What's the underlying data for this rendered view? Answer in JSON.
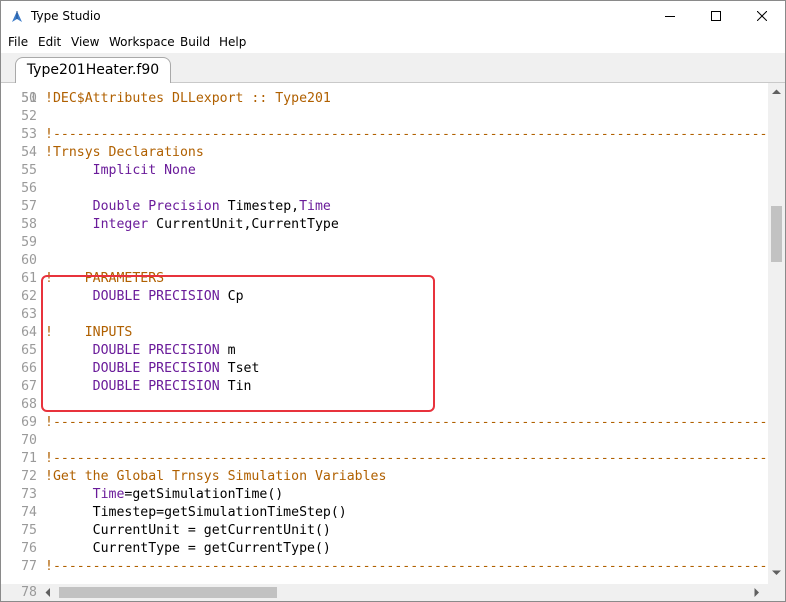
{
  "window": {
    "title": "Type Studio"
  },
  "menu": [
    "File",
    "Edit",
    "View",
    "Workspace",
    "Build",
    "Help"
  ],
  "tab": {
    "label": "Type201Heater.f90"
  },
  "lines": [
    {
      "n": "51",
      "segs": [
        {
          "t": "!DEC$Attributes DLLexport :: Type201",
          "c": "c-comment"
        }
      ]
    },
    {
      "n": "52",
      "segs": []
    },
    {
      "n": "53",
      "segs": [
        {
          "t": "!-----------------------------------------------------------------------------------------------------------",
          "c": "c-comment"
        }
      ]
    },
    {
      "n": "54",
      "segs": [
        {
          "t": "!Trnsys Declarations",
          "c": "c-comment"
        }
      ]
    },
    {
      "n": "55",
      "segs": [
        {
          "t": "      ",
          "c": "c-plain"
        },
        {
          "t": "Implicit None",
          "c": "c-kw"
        }
      ]
    },
    {
      "n": "56",
      "segs": []
    },
    {
      "n": "57",
      "segs": [
        {
          "t": "      ",
          "c": "c-plain"
        },
        {
          "t": "Double Precision",
          "c": "c-kw"
        },
        {
          "t": " Timestep,",
          "c": "c-plain"
        },
        {
          "t": "Time",
          "c": "c-kw"
        }
      ]
    },
    {
      "n": "58",
      "segs": [
        {
          "t": "      ",
          "c": "c-plain"
        },
        {
          "t": "Integer",
          "c": "c-kw"
        },
        {
          "t": " CurrentUnit,CurrentType",
          "c": "c-plain"
        }
      ]
    },
    {
      "n": "59",
      "segs": []
    },
    {
      "n": "60",
      "segs": []
    },
    {
      "n": "61",
      "segs": [
        {
          "t": "!    PARAMETERS",
          "c": "c-comment"
        }
      ]
    },
    {
      "n": "62",
      "segs": [
        {
          "t": "      ",
          "c": "c-plain"
        },
        {
          "t": "DOUBLE PRECISION",
          "c": "c-kw"
        },
        {
          "t": " Cp",
          "c": "c-plain"
        }
      ]
    },
    {
      "n": "63",
      "segs": []
    },
    {
      "n": "64",
      "segs": [
        {
          "t": "!    INPUTS",
          "c": "c-comment"
        }
      ]
    },
    {
      "n": "65",
      "segs": [
        {
          "t": "      ",
          "c": "c-plain"
        },
        {
          "t": "DOUBLE PRECISION",
          "c": "c-kw"
        },
        {
          "t": " m",
          "c": "c-plain"
        }
      ]
    },
    {
      "n": "66",
      "segs": [
        {
          "t": "      ",
          "c": "c-plain"
        },
        {
          "t": "DOUBLE PRECISION",
          "c": "c-kw"
        },
        {
          "t": " Tset",
          "c": "c-plain"
        }
      ]
    },
    {
      "n": "67",
      "segs": [
        {
          "t": "      ",
          "c": "c-plain"
        },
        {
          "t": "DOUBLE PRECISION",
          "c": "c-kw"
        },
        {
          "t": " Tin",
          "c": "c-plain"
        }
      ]
    },
    {
      "n": "68",
      "segs": []
    },
    {
      "n": "69",
      "segs": [
        {
          "t": "!-----------------------------------------------------------------------------------------------------------",
          "c": "c-comment"
        }
      ]
    },
    {
      "n": "70",
      "segs": []
    },
    {
      "n": "71",
      "segs": [
        {
          "t": "!-----------------------------------------------------------------------------------------------------------",
          "c": "c-comment"
        }
      ]
    },
    {
      "n": "72",
      "segs": [
        {
          "t": "!Get the Global Trnsys Simulation Variables",
          "c": "c-comment"
        }
      ]
    },
    {
      "n": "73",
      "segs": [
        {
          "t": "      ",
          "c": "c-plain"
        },
        {
          "t": "Time",
          "c": "c-kw"
        },
        {
          "t": "=getSimulationTime()",
          "c": "c-plain"
        }
      ]
    },
    {
      "n": "74",
      "segs": [
        {
          "t": "      Timestep=getSimulationTimeStep()",
          "c": "c-plain"
        }
      ]
    },
    {
      "n": "75",
      "segs": [
        {
          "t": "      CurrentUnit = getCurrentUnit()",
          "c": "c-plain"
        }
      ]
    },
    {
      "n": "76",
      "segs": [
        {
          "t": "      CurrentType = getCurrentType()",
          "c": "c-plain"
        }
      ]
    },
    {
      "n": "77",
      "segs": [
        {
          "t": "!-----------------------------------------------------------------------------------------------------------",
          "c": "c-comment"
        }
      ]
    }
  ],
  "partial_line_top": "50",
  "partial_line_bottom": "78",
  "colors": {
    "comment": "#b06000",
    "keyword": "#6a1b9a",
    "highlight": "#e8323c"
  }
}
